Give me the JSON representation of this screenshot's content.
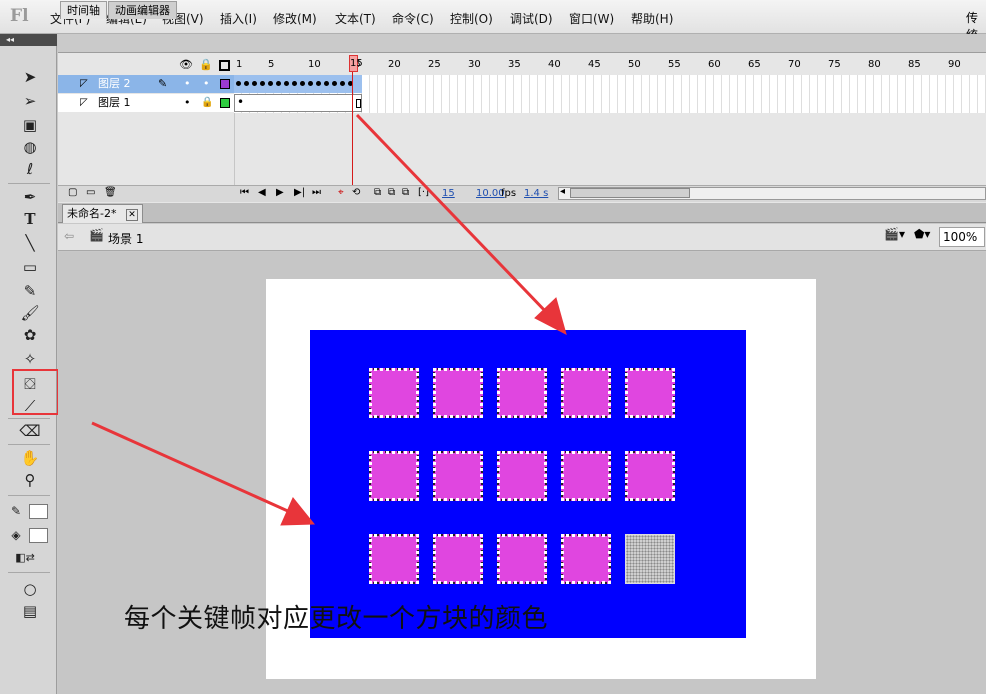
{
  "app": {
    "logo": "Fl",
    "mode_label": "传统"
  },
  "menu": [
    "文件(F)",
    "编辑(E)",
    "视图(V)",
    "插入(I)",
    "修改(M)",
    "文本(T)",
    "命令(C)",
    "控制(O)",
    "调试(D)",
    "窗口(W)",
    "帮助(H)"
  ],
  "toolbar": {
    "collapse": "◂◂",
    "tools": [
      "selection-arrow-icon",
      "subselect-arrow-icon",
      "free-transform-icon",
      "3d-rotation-icon",
      "lasso-icon",
      "pen-icon",
      "text-icon",
      "line-icon",
      "rectangle-icon",
      "pencil-icon",
      "brush-icon",
      "deco-icon",
      "bone-icon",
      "paint-bucket-icon",
      "eyedropper-icon",
      "eraser-icon",
      "hand-icon",
      "zoom-icon"
    ]
  },
  "timeline": {
    "tabs": [
      "时间轴",
      "动画编辑器"
    ],
    "frame_numbers": [
      "1",
      "5",
      "10",
      "15",
      "20",
      "25",
      "30",
      "35",
      "40",
      "45",
      "50",
      "55",
      "60",
      "65",
      "70",
      "75",
      "80",
      "85",
      "90"
    ],
    "playhead": "15",
    "layers": [
      {
        "name": "图层 2",
        "selected": true,
        "color": "#9b3ad1"
      },
      {
        "name": "图层 1",
        "selected": false,
        "color": "#2ecc40"
      }
    ],
    "footer": {
      "current_frame": "15",
      "fps": "10.00",
      "fps_unit": "fps",
      "time": "1.4 s"
    }
  },
  "document": {
    "tab_title": "未命名-2*",
    "scene": "场景 1",
    "zoom": "100%"
  },
  "stage": {
    "background": "#ffffff",
    "rect_color": "#0000ff",
    "square_color": "#e046e0",
    "grid_rows": 3,
    "grid_cols": 5,
    "filled_count": 14
  },
  "annotation": {
    "caption": "每个关键帧对应更改一个方块的颜色"
  }
}
